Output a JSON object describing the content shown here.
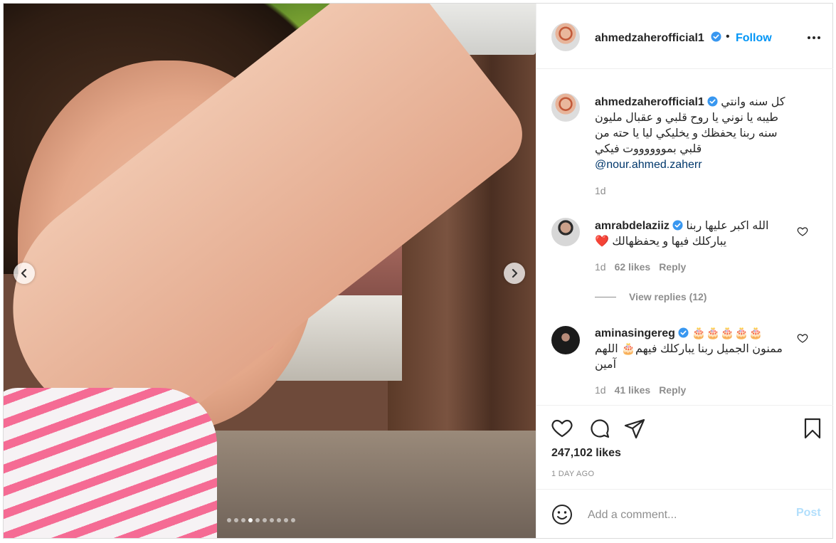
{
  "post": {
    "author": "ahmedzaherofficial1",
    "separator": "•",
    "follow_label": "Follow",
    "carousel": {
      "dot_count": 10,
      "active_index": 3
    },
    "caption": {
      "username": "ahmedzaherofficial1",
      "text": "كل سنه وانتي طيبه يا نوني يا روح قلبي و عقبال مليون سنه ربنا يحفظك و يخليكي ليا يا حته من قلبي بمووووووت فيكي",
      "mention": "@nour.ahmed.zaherr",
      "time": "1d"
    },
    "comments": [
      {
        "username": "amrabdelaziiz",
        "text": "الله اكبر عليها ربنا يباركلك فيها و يحفظهالك ❤️",
        "time": "1d",
        "likes": "62 likes",
        "reply_label": "Reply",
        "view_replies": "View replies (12)"
      },
      {
        "username": "aminasingereg",
        "text": "🎂🎂🎂🎂🎂 ممنون الجميل ربنا يباركلك فيهم🎂 اللهم آمين",
        "time": "1d",
        "likes": "41 likes",
        "reply_label": "Reply"
      }
    ],
    "likes_count": "247,102 likes",
    "posted_ago": "1 DAY AGO",
    "add_comment": {
      "placeholder": "Add a comment...",
      "post_label": "Post"
    }
  },
  "colors": {
    "accent": "#0095f6",
    "verified": "#3897f0",
    "muted": "#8e8e8e",
    "post_disabled": "#b2dffc",
    "heart_red": "#ed4956"
  },
  "icons": [
    "chevron-left-icon",
    "chevron-right-icon",
    "verified-badge-icon",
    "more-options-icon",
    "heart-icon",
    "comment-icon",
    "share-icon",
    "bookmark-icon",
    "emoji-icon"
  ]
}
